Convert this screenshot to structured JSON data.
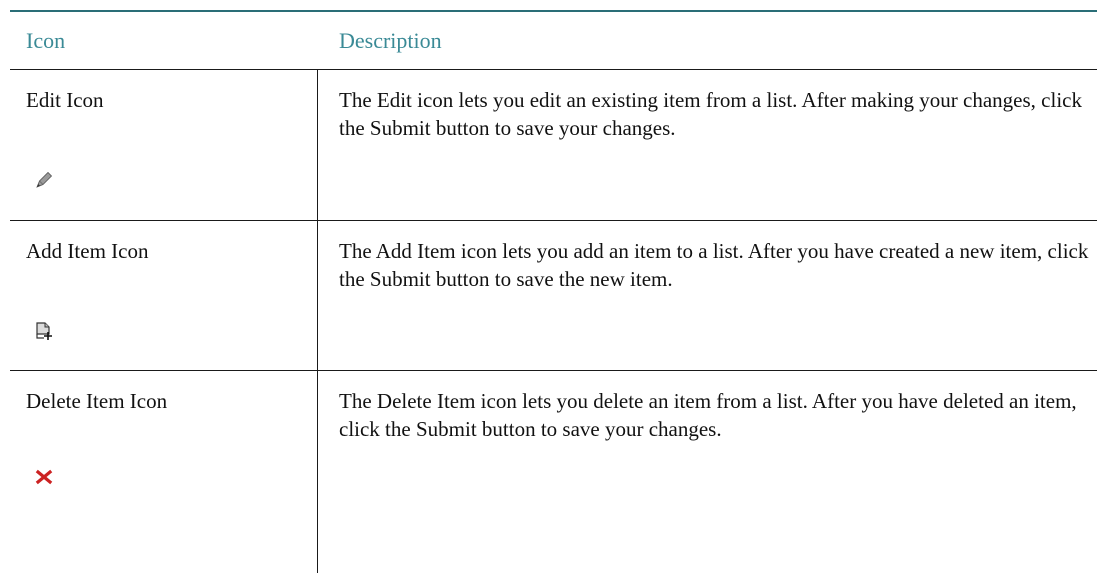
{
  "header": {
    "icon_label": "Icon",
    "description_label": "Description"
  },
  "rows": [
    {
      "name": "Edit Icon",
      "icon": "pencil-icon",
      "description": "The Edit icon lets you edit an existing item from a list. After making your changes, click the Submit button to save your changes."
    },
    {
      "name": "Add Item Icon",
      "icon": "add-document-icon",
      "description": "The Add Item icon lets you add an item to a list. After you have created a new item, click the Submit button to save the new item."
    },
    {
      "name": "Delete Item Icon",
      "icon": "red-x-icon",
      "description": "The Delete Item icon lets you delete an item from a list. After you have deleted an item, click the Submit button to save your changes."
    }
  ],
  "colors": {
    "header_text": "#3a8a96",
    "header_rule": "#2a6e77",
    "delete_icon": "#cc2222"
  }
}
